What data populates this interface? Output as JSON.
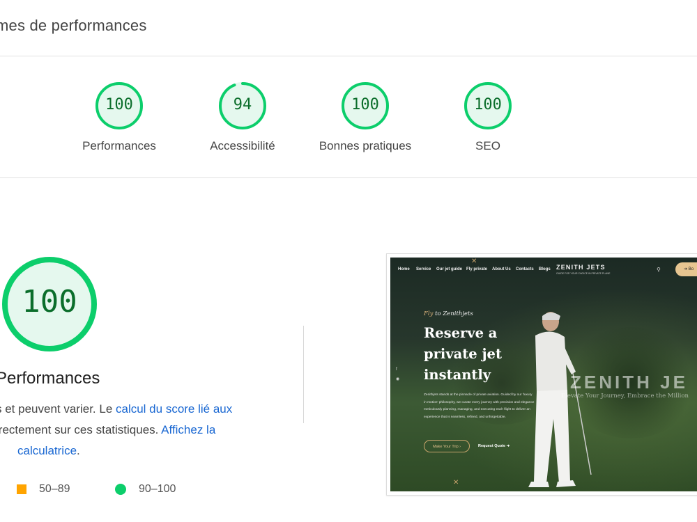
{
  "header": {
    "title": "mes de performances"
  },
  "gauges": [
    {
      "score": "100",
      "label": "Performances",
      "value": 100
    },
    {
      "score": "94",
      "label": "Accessibilité",
      "value": 94
    },
    {
      "score": "100",
      "label": "Bonnes pratiques",
      "value": 100
    },
    {
      "score": "100",
      "label": "SEO",
      "value": 100
    }
  ],
  "summary": {
    "score": "100",
    "value": 100,
    "label": "Performances",
    "line1_text": "s et peuvent varier. Le ",
    "line1_link": "calcul du score lié aux",
    "line2_text": "irectement sur ces statistiques. ",
    "line2_link": "Affichez la",
    "line3_link": "calculatrice",
    "line3_end": "."
  },
  "legend": [
    {
      "range": "50–89",
      "shape": "square",
      "color": "#ffa400"
    },
    {
      "range": "90–100",
      "shape": "circle",
      "color": "#0cce6b"
    }
  ],
  "colors": {
    "pass_green": "#0cce6b",
    "score_text": "#0b6e2b",
    "gauge_bg": "#e5f8ee",
    "link": "#1967d2"
  },
  "screenshot": {
    "nav": [
      "Home",
      "Service",
      "Our jet guide",
      "Fly private",
      "About Us",
      "Contacts",
      "Blogs"
    ],
    "logo": "ZENITH JETS",
    "logo_sub": "GUIDE FOR YOUR CHOICE IN PRIVATE PLANE",
    "book_button": "Bo",
    "fly_prefix": "Fly",
    "fly_suffix": " to Zenithjets",
    "hero_line1": "Reserve a",
    "hero_line2": "private jet",
    "hero_line3": "instantly",
    "paragraph": "Zenithjets stands at the pinnacle of private aviation. Guided by our 'luxury in motion' philosophy, we curate every journey with precision and elegance meticulously planning, managing, and executing each flight to deliver an experience that is seamless, refined, and unforgettable.",
    "trip_button": "Make Your Trip",
    "quote_link": "Request Quote",
    "watermark": "ZENITH JE",
    "watermark_sub": "Elevate Your Journey, Embrace the Million"
  }
}
